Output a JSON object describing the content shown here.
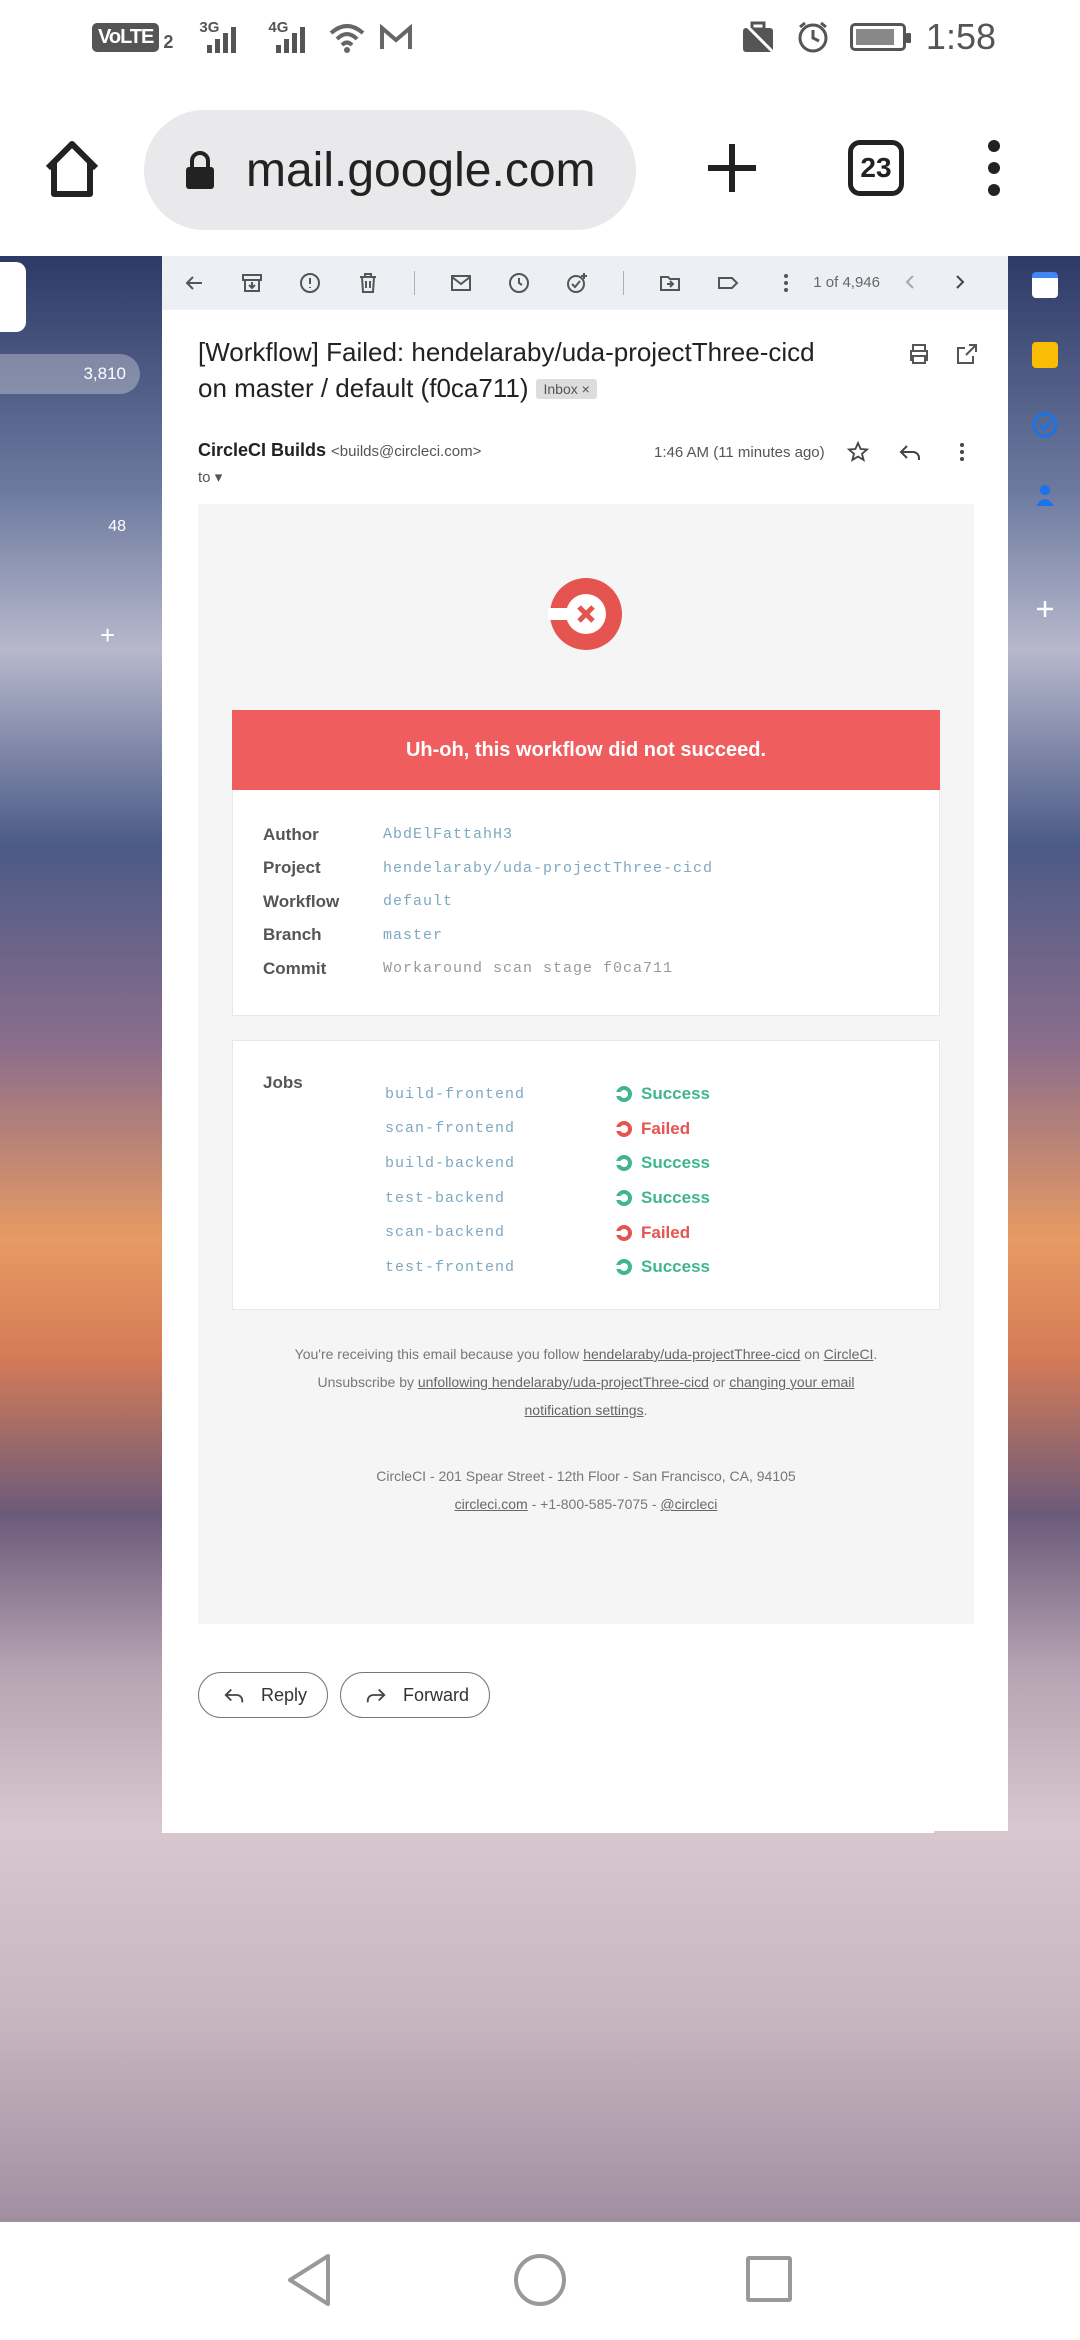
{
  "statusbar": {
    "volte": "VoLTE",
    "sim": "2",
    "net1": "3G",
    "net2": "4G",
    "time": "1:58"
  },
  "browser": {
    "url": "mail.google.com",
    "tab_count": "23"
  },
  "left_panel": {
    "inbox_count": "3,810",
    "other_count": "48",
    "plus": "+"
  },
  "toolbar": {
    "pager": "1 of 4,946"
  },
  "email": {
    "subject_line1": "[Workflow] Failed: hendelaraby/uda-projectThree-cicd",
    "subject_line2": "on master / default (f0ca711)",
    "label": "Inbox",
    "label_close": "×",
    "sender_name": "CircleCI Builds",
    "sender_email": "<builds@circleci.com>",
    "to": "to",
    "time": "1:46 AM (11 minutes ago)"
  },
  "body": {
    "banner": "Uh-oh, this workflow did not succeed.",
    "meta": [
      {
        "k": "Author",
        "v": "AbdElFattahH3"
      },
      {
        "k": "Project",
        "v": "hendelaraby/uda-projectThree-cicd"
      },
      {
        "k": "Workflow",
        "v": "default"
      },
      {
        "k": "Branch",
        "v": "master"
      },
      {
        "k": "Commit",
        "v": "Workaround scan stage f0ca711"
      }
    ],
    "jobs_label": "Jobs",
    "jobs": [
      {
        "name": "build-frontend",
        "status": "Success"
      },
      {
        "name": "scan-frontend",
        "status": "Failed"
      },
      {
        "name": "build-backend",
        "status": "Success"
      },
      {
        "name": "test-backend",
        "status": "Success"
      },
      {
        "name": "scan-backend",
        "status": "Failed"
      },
      {
        "name": "test-frontend",
        "status": "Success"
      }
    ],
    "colors": {
      "success": "#3fb68b",
      "failed": "#e5544f",
      "banner": "#f05d5e"
    },
    "footer": {
      "l1_pre": "You're receiving this email because you follow ",
      "l1_link": "hendelaraby/uda-projectThree-cicd",
      "l1_mid": " on ",
      "l1_link2": "CircleCI",
      "l1_end": ".",
      "l2_pre": "Unsubscribe by ",
      "l2_link": "unfollowing hendelaraby/uda-projectThree-cicd",
      "l2_mid": " or ",
      "l2_link2": "changing your email",
      "l3_link": "notification settings",
      "l3_end": ".",
      "address": "CircleCI - 201 Spear Street - 12th Floor - San Francisco, CA, 94105",
      "site": "circleci.com",
      "phone": " - +1-800-585-7075 - ",
      "twitter": "@circleci"
    }
  },
  "actions": {
    "reply": "Reply",
    "forward": "Forward"
  }
}
